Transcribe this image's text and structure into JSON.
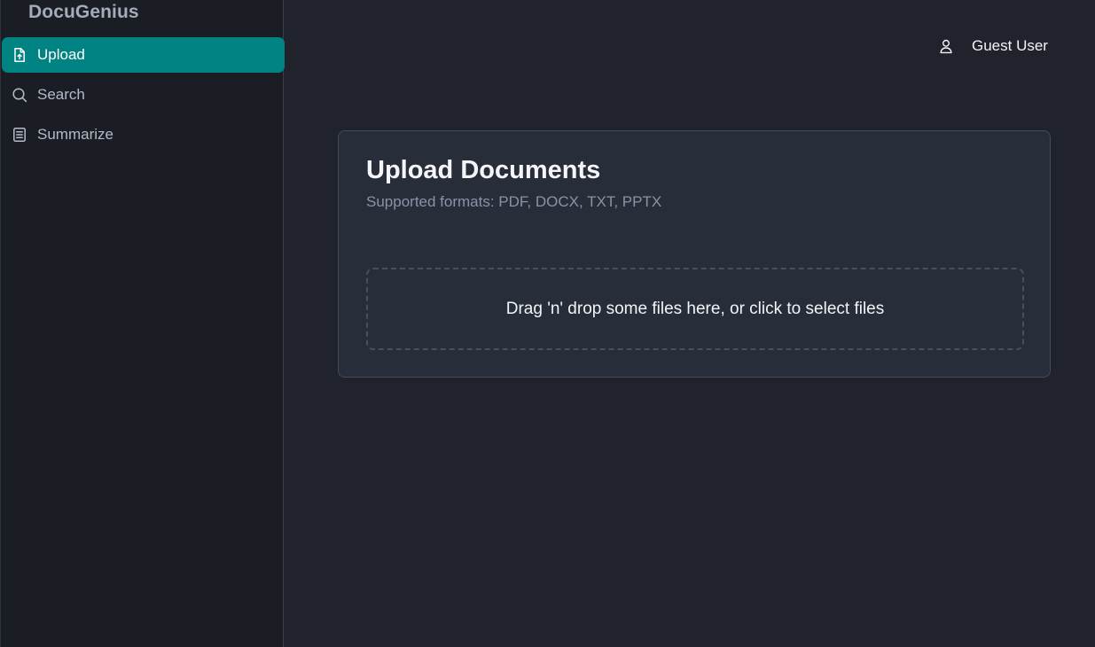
{
  "app": {
    "brand": "DocuGenius"
  },
  "sidebar": {
    "items": [
      {
        "label": "Upload",
        "icon": "file-upload-icon",
        "active": true
      },
      {
        "label": "Search",
        "icon": "search-icon",
        "active": false
      },
      {
        "label": "Summarize",
        "icon": "document-text-icon",
        "active": false
      }
    ]
  },
  "header": {
    "user_name": "Guest User",
    "user_icon": "user-icon"
  },
  "upload_card": {
    "title": "Upload Documents",
    "subtitle": "Supported formats: PDF, DOCX, TXT, PPTX",
    "dropzone_text": "Drag 'n' drop some files here, or click to select files"
  },
  "colors": {
    "accent": "#028383",
    "background": "#20232c",
    "sidebar": "#1b1d24",
    "card": "#282d3a"
  }
}
